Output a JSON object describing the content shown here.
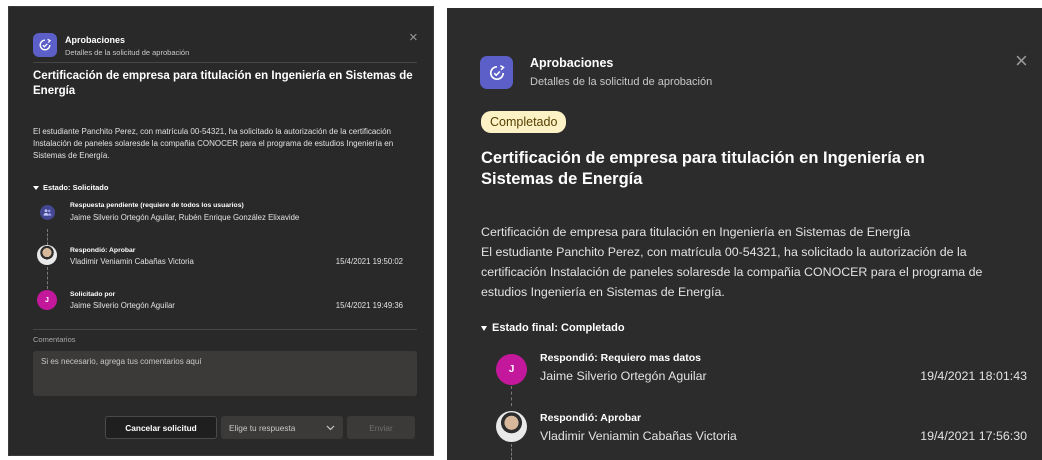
{
  "left": {
    "app_title": "Aprobaciones",
    "app_subtitle": "Detalles de la solicitud de aprobación",
    "close_glyph": "×",
    "request_title": "Certificación de empresa para titulación en Ingeniería en Sistemas de Energía",
    "description": "El estudiante Panchito Perez, con matrícula 00-54321, ha solicitado la autorización de la certificación Instalación de paneles solaresde la compañia CONOCER para el programa de estudios Ingeniería en Sistemas de Energía.",
    "section_label": "Estado: Solicitado",
    "events": [
      {
        "avatar": "group-icon",
        "heading": "Respuesta pendiente (requiere de todos los usuarios)",
        "name": "Jaime Silverio Ortegón Aguilar, Rubén Enrique González Elixavide",
        "date": ""
      },
      {
        "avatar": "photo",
        "heading": "Respondió: Aprobar",
        "name": "Vladimir Veniamin Cabañas Victoria",
        "date": "15/4/2021 19:50:02"
      },
      {
        "avatar": "J",
        "heading": "Solicitado por",
        "name": "Jaime Silverio Ortegón Aguilar",
        "date": "15/4/2021 19:49:36"
      }
    ],
    "comments_label": "Comentarios",
    "comments_placeholder": "Si es necesario, agrega tus comentarios aquí",
    "cancel_button": "Cancelar solicitud",
    "response_select": "Elige tu respuesta",
    "send_button": "Enviar"
  },
  "right": {
    "app_title": "Aprobaciones",
    "app_subtitle": "Detalles de la solicitud de aprobación",
    "close_glyph": "×",
    "status_badge": "Completado",
    "request_title": "Certificación de empresa para titulación en Ingeniería en Sistemas de Energía",
    "description_line1": "Certificación de empresa para titulación en Ingeniería en Sistemas de Energía",
    "description": "El estudiante Panchito Perez, con matrícula 00-54321, ha solicitado la autorización de la certificación Instalación de paneles solaresde la compañia CONOCER para el programa de estudios Ingeniería en Sistemas de Energía.",
    "section_label": "Estado final: Completado",
    "events": [
      {
        "avatar": "J",
        "heading": "Respondió: Requiero mas datos",
        "name": "Jaime Silverio Ortegón Aguilar",
        "date": "19/4/2021 18:01:43"
      },
      {
        "avatar": "photo",
        "heading": "Respondió: Aprobar",
        "name": "Vladimir Veniamin Cabañas Victoria",
        "date": "19/4/2021 17:56:30"
      }
    ]
  },
  "colors": {
    "panel_bg": "#292929",
    "accent": "#5b5fc7",
    "pink_avatar": "#c4189c",
    "badge_bg": "#fdf1c6",
    "badge_text": "#574000"
  }
}
